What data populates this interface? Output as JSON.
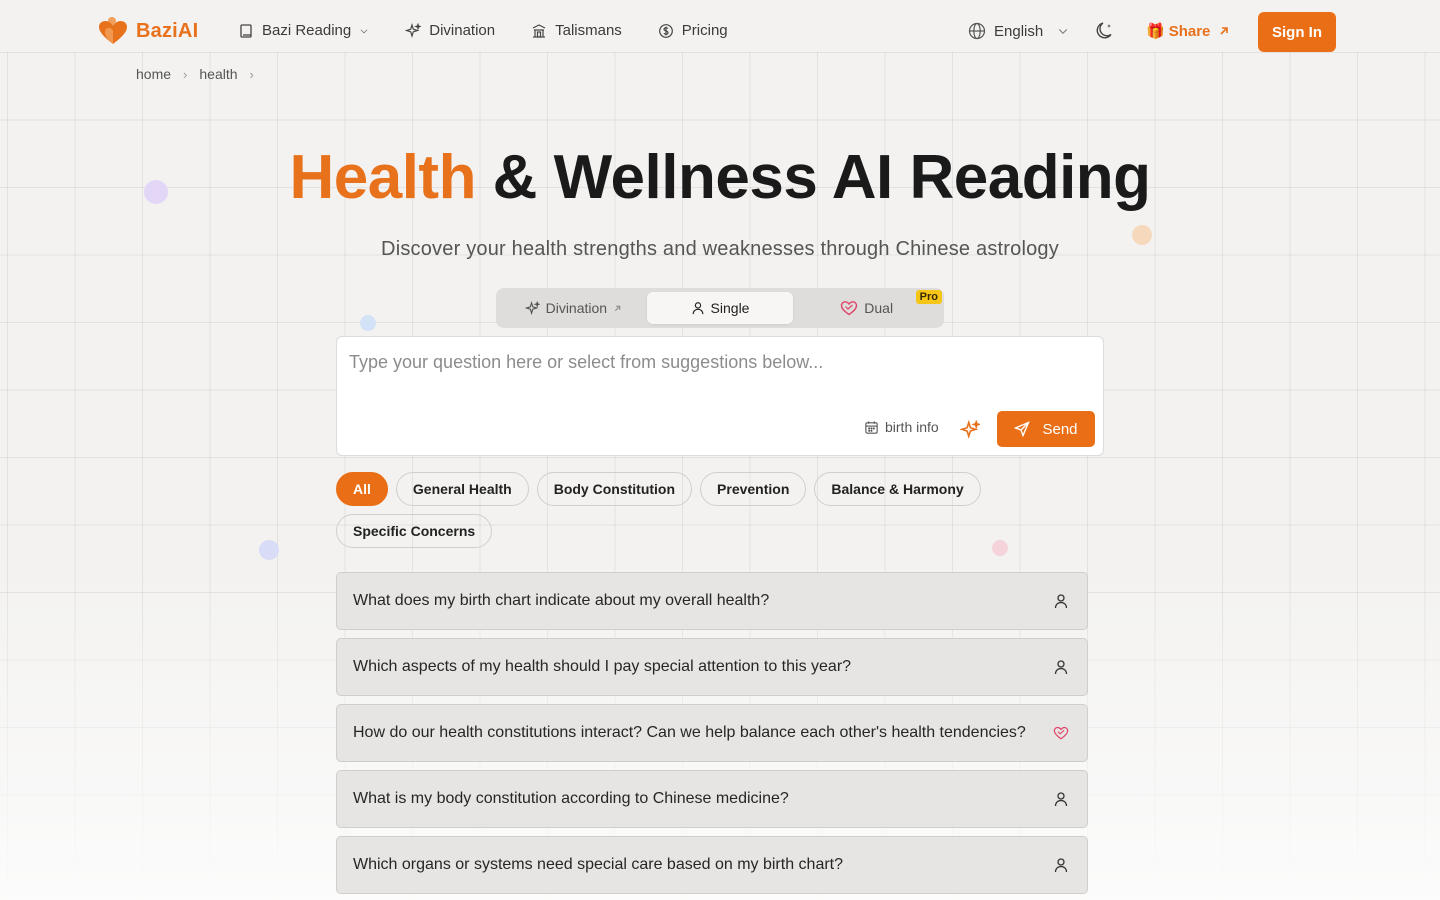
{
  "app": {
    "name": "BaziAI",
    "brand_color": "#ea6e15"
  },
  "nav": {
    "items": [
      {
        "label": "Bazi Reading",
        "icon": "book-icon",
        "has_dropdown": true
      },
      {
        "label": "Divination",
        "icon": "sparkles-icon"
      },
      {
        "label": "Talismans",
        "icon": "temple-icon"
      },
      {
        "label": "Pricing",
        "icon": "dollar-circle-icon"
      }
    ],
    "language": "English",
    "share_label": "Share",
    "signin_label": "Sign In"
  },
  "breadcrumb": [
    "home",
    "health"
  ],
  "hero": {
    "title_accent": "Health",
    "title_rest": " & Wellness AI Reading",
    "subtitle": "Discover your health strengths and weaknesses through Chinese astrology"
  },
  "mode_switch": {
    "options": [
      {
        "label": "Divination",
        "external": true
      },
      {
        "label": "Single",
        "active": true
      },
      {
        "label": "Dual",
        "badge": "Pro"
      }
    ]
  },
  "query": {
    "placeholder": "Type your question here or select from suggestions below...",
    "birth_info_label": "birth info",
    "send_label": "Send"
  },
  "categories": [
    {
      "label": "All",
      "active": true
    },
    {
      "label": "General Health"
    },
    {
      "label": "Body Constitution"
    },
    {
      "label": "Prevention"
    },
    {
      "label": "Balance & Harmony"
    },
    {
      "label": "Specific Concerns"
    }
  ],
  "questions": [
    {
      "text": "What does my birth chart indicate about my overall health?",
      "icon": "user-icon"
    },
    {
      "text": "Which aspects of my health should I pay special attention to this year?",
      "icon": "user-icon"
    },
    {
      "text": "How do our health constitutions interact? Can we help balance each other's health tendencies?",
      "icon": "heart-icon"
    },
    {
      "text": "What is my body constitution according to Chinese medicine?",
      "icon": "user-icon"
    },
    {
      "text": "Which organs or systems need special care based on my birth chart?",
      "icon": "user-icon"
    }
  ]
}
